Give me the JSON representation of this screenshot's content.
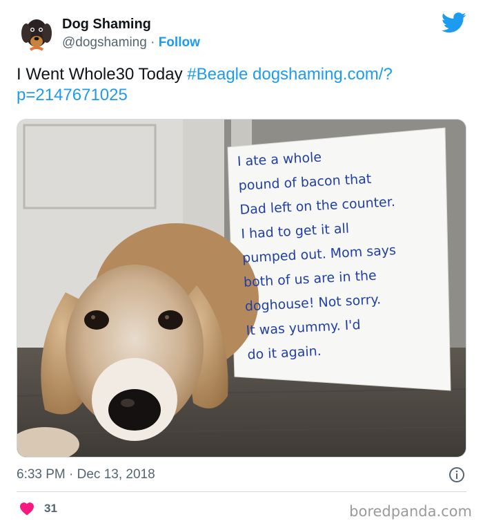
{
  "header": {
    "display_name": "Dog Shaming",
    "handle": "@dogshaming",
    "separator": " · ",
    "follow_label": "Follow",
    "avatar_icon": "dachshund-avatar",
    "platform_icon": "twitter-bird-icon"
  },
  "tweet": {
    "text_plain": "I Went Whole30 Today ",
    "hashtag": "#Beagle",
    "link_line1": " dogshaming.com/?",
    "link_line2": "p=2147671025"
  },
  "photo": {
    "sign_lines": [
      "I  ate  a  whole",
      "pound  of  bacon  that",
      "Dad  left  on  the  counter.",
      "I  had  to  get  it  all",
      "pumped  out.  Mom  says",
      "both  of  us  are  in  the",
      "doghouse!  Not  sorry.",
      "It  was  yummy.  I'd",
      "do  it  again."
    ]
  },
  "footer": {
    "timestamp": "6:33 PM · Dec 13, 2018",
    "like_count": "31",
    "watermark": "boredpanda.com"
  },
  "colors": {
    "link": "#1d9bf0",
    "like": "#f91880",
    "muted": "#536471",
    "ink": "#1f3fa6"
  }
}
